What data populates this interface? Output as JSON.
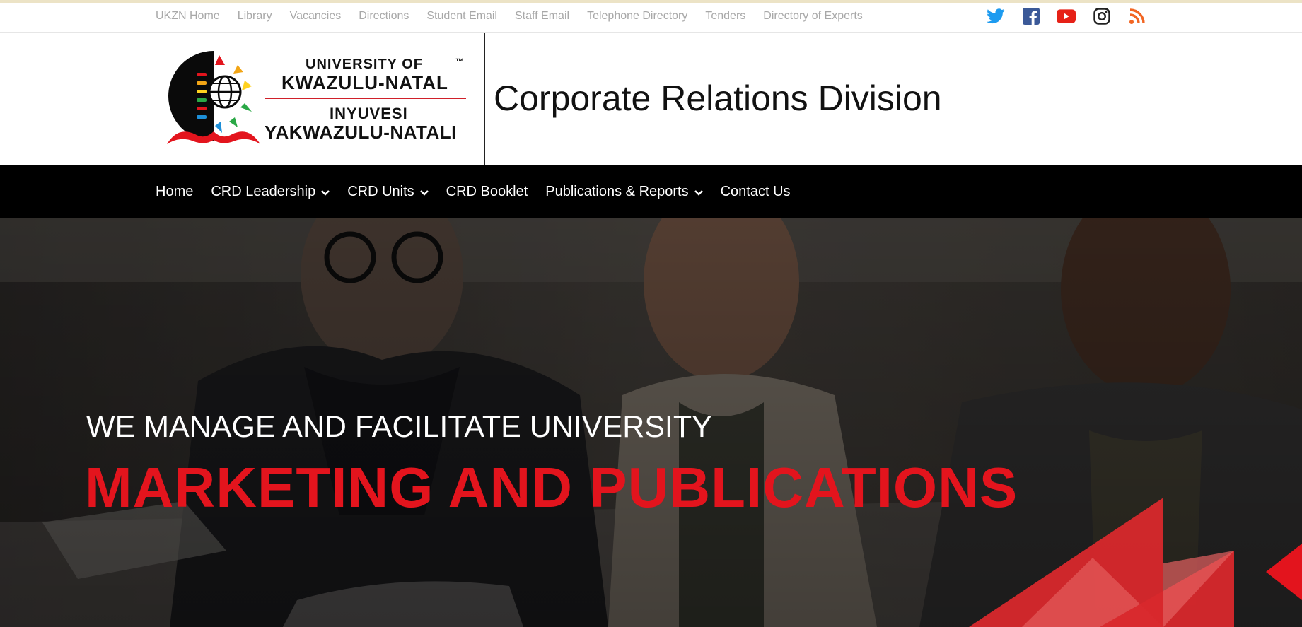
{
  "topbar": {
    "links": [
      {
        "label": "UKZN Home"
      },
      {
        "label": "Library"
      },
      {
        "label": "Vacancies"
      },
      {
        "label": "Directions"
      },
      {
        "label": "Student Email"
      },
      {
        "label": "Staff Email"
      },
      {
        "label": "Telephone Directory"
      },
      {
        "label": "Tenders"
      },
      {
        "label": "Directory of Experts"
      }
    ],
    "socials": [
      {
        "icon": "twitter-icon",
        "color": "#1d9bf0"
      },
      {
        "icon": "facebook-icon",
        "color": "#3b5998"
      },
      {
        "icon": "youtube-icon",
        "color": "#e62117"
      },
      {
        "icon": "instagram-icon",
        "color": "#222222"
      },
      {
        "icon": "rss-icon",
        "color": "#f26522"
      }
    ]
  },
  "header": {
    "logo": {
      "line1": "UNIVERSITY OF",
      "line2": "KWAZULU-NATAL",
      "line3": "INYUVESI",
      "line4": "YAKWAZULU-NATALI",
      "tm": "™"
    },
    "title": "Corporate Relations Division"
  },
  "nav": {
    "items": [
      {
        "label": "Home",
        "dropdown": false
      },
      {
        "label": "CRD Leadership",
        "dropdown": true
      },
      {
        "label": "CRD Units",
        "dropdown": true
      },
      {
        "label": "CRD Booklet",
        "dropdown": false
      },
      {
        "label": "Publications & Reports",
        "dropdown": true
      },
      {
        "label": "Contact Us",
        "dropdown": false
      }
    ]
  },
  "hero": {
    "subtitle": "WE MANAGE AND FACILITATE UNIVERSITY",
    "title": "MARKETING AND PUBLICATIONS",
    "accent_color": "#e3141d"
  }
}
